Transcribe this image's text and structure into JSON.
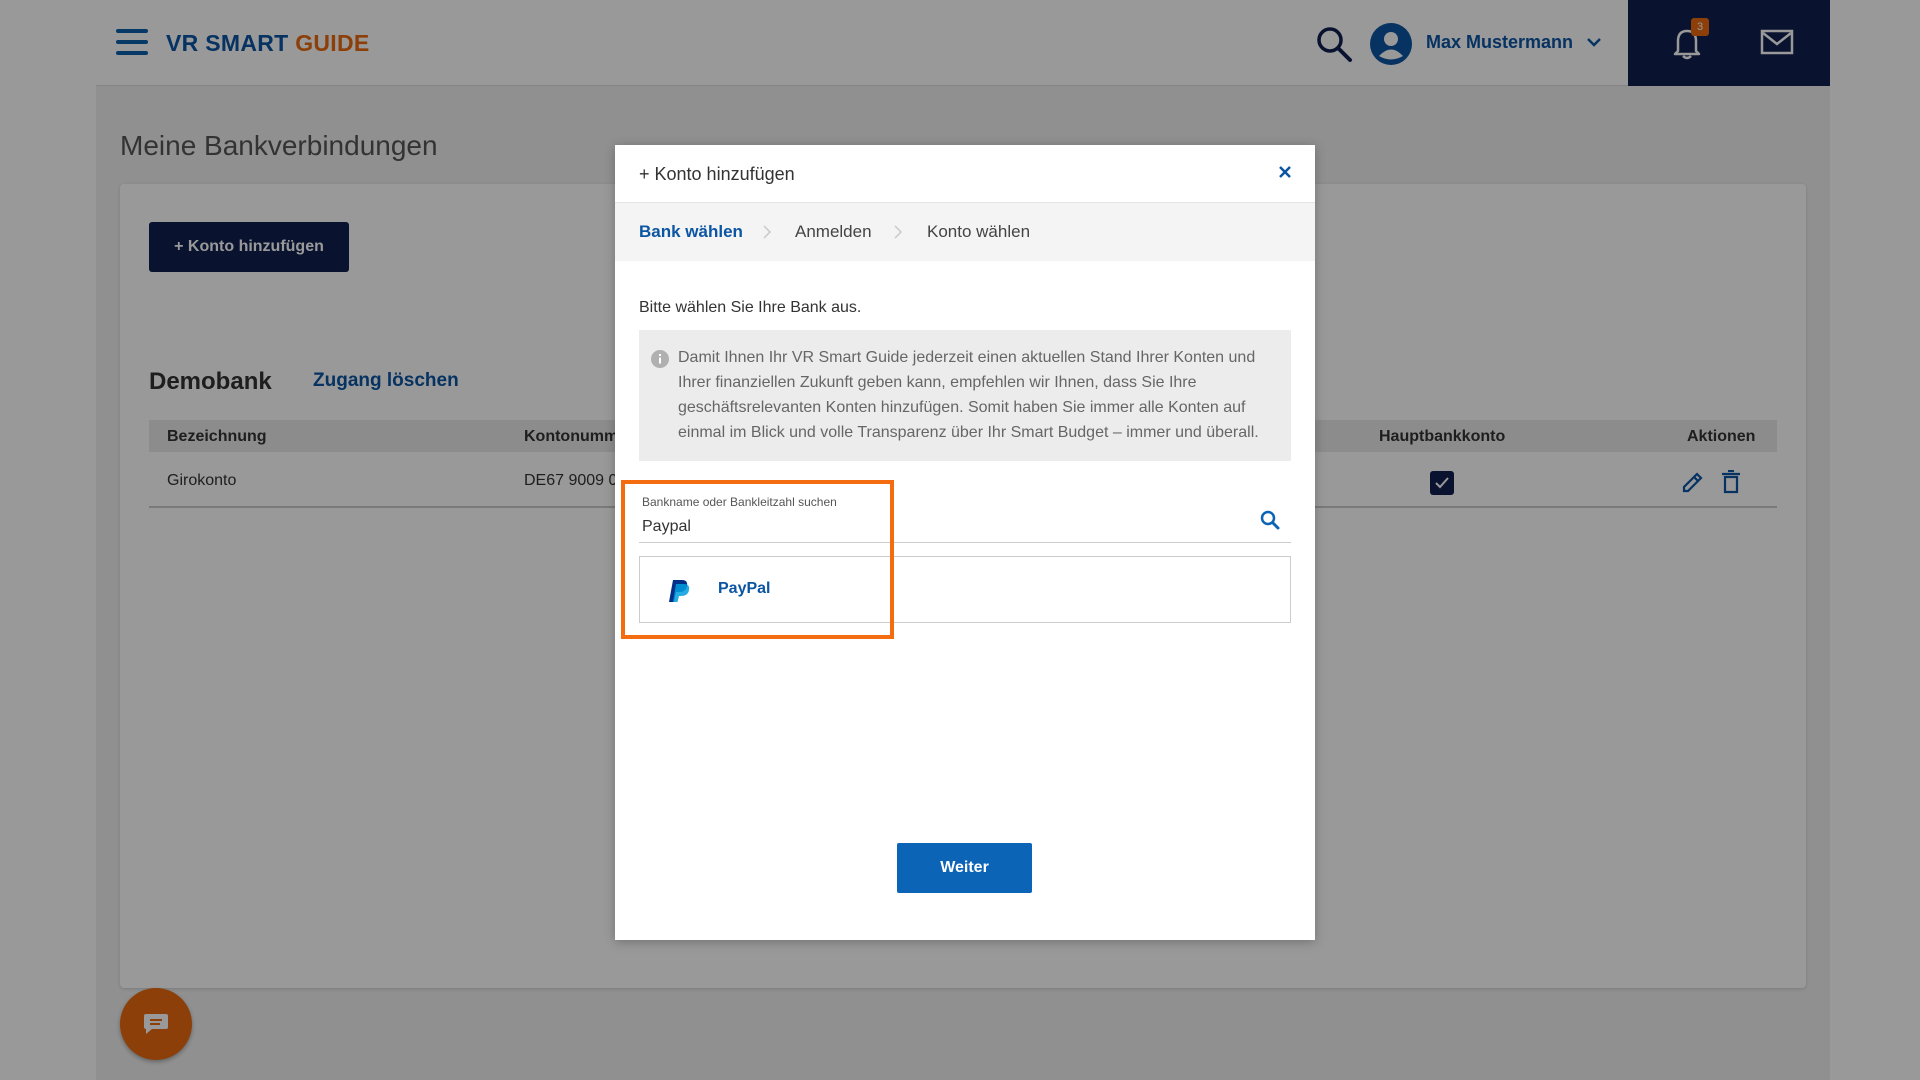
{
  "header": {
    "logo_part1": "VR SMART ",
    "logo_part2": "GUIDE",
    "user_name": "Max Mustermann",
    "notification_count": "3",
    "icons": [
      "menu-icon",
      "search-icon",
      "user-avatar-icon",
      "chevron-down-icon",
      "bell-icon",
      "mail-icon"
    ]
  },
  "page": {
    "title": "Meine Bankverbindungen",
    "add_button": "+ Konto hinzufügen",
    "bank": {
      "name": "Demobank",
      "delete_link": "Zugang löschen"
    },
    "table": {
      "columns": [
        "Bezeichnung",
        "Kontonumm",
        "Hauptbankkonto",
        "Aktionen"
      ],
      "rows": [
        {
          "name": "Girokonto",
          "account": "DE67 9009 0",
          "main_account_checked": true
        }
      ]
    }
  },
  "modal": {
    "title": "+ Konto hinzufügen",
    "steps": [
      "Bank wählen",
      "Anmelden",
      "Konto wählen"
    ],
    "active_step": "Bank wählen",
    "prompt": "Bitte wählen Sie Ihre Bank aus.",
    "info_text": "Damit Ihnen Ihr VR Smart Guide jederzeit einen aktuellen Stand Ihrer Konten und Ihrer finanziellen Zukunft geben kann, empfehlen wir Ihnen, dass Sie Ihre geschäftsrelevanten Konten hinzufügen. Somit haben Sie immer alle Konten auf einmal im Blick und volle Transparenz über Ihr Smart Budget – immer und überall.",
    "search_label": "Bankname oder Bankleitzahl suchen",
    "search_value": "Paypal",
    "results": [
      {
        "name": "PayPal",
        "icon": "paypal-icon"
      }
    ],
    "next_button": "Weiter"
  },
  "colors": {
    "brand_blue": "#0b55a3",
    "brand_orange": "#e9690f",
    "navy": "#0f1f4f",
    "button_blue": "#0c64b7",
    "highlight": "#f36c10"
  }
}
